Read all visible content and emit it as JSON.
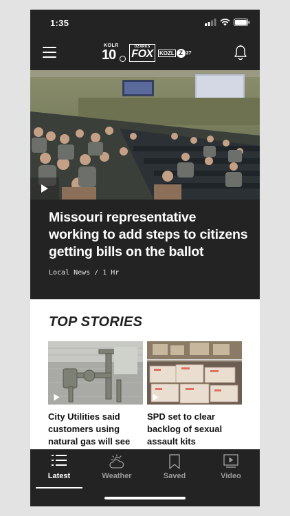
{
  "status_bar": {
    "time": "1:35"
  },
  "header": {
    "logos": {
      "kolr_top": "KOLR",
      "kolr_num": "10",
      "fox_top": "OZARKS",
      "fox_main": "FOX",
      "kozl_text": "KOZL",
      "kozl_z": "Z",
      "kozl_num": "27"
    }
  },
  "hero": {
    "headline": "Missouri representative working to add steps to citizens getting bills on the ballot",
    "meta": "Local News / 1 Hr"
  },
  "top_stories": {
    "title": "TOP STORIES",
    "items": [
      {
        "headline": "City Utilities said customers using natural gas will see"
      },
      {
        "headline": "SPD set to clear backlog of sexual assault kits"
      }
    ]
  },
  "tab_bar": {
    "tabs": [
      {
        "label": "Latest",
        "icon": "list-icon",
        "active": true
      },
      {
        "label": "Weather",
        "icon": "weather-icon",
        "active": false
      },
      {
        "label": "Saved",
        "icon": "bookmark-icon",
        "active": false
      },
      {
        "label": "Video",
        "icon": "video-icon",
        "active": false
      }
    ]
  },
  "colors": {
    "background": "#e3e3e3",
    "app_dark": "#232323",
    "text_white": "#ffffff",
    "inactive_tab": "#9b9b9b"
  }
}
